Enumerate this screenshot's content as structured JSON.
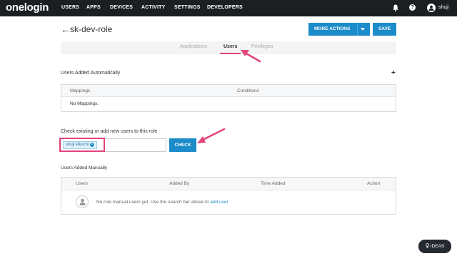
{
  "nav": {
    "logo": "onelogin",
    "items": [
      "USERS",
      "APPS",
      "DEVICES",
      "ACTIVITY",
      "SETTINGS",
      "DEVELOPERS"
    ],
    "help": "?",
    "username": "shuji"
  },
  "page": {
    "title": "sk-dev-role",
    "back_arrow": "←",
    "more_actions": "MORE ACTIONS",
    "save": "SAVE"
  },
  "tabs": [
    {
      "label": "Applications",
      "active": false
    },
    {
      "label": "Users",
      "active": true
    },
    {
      "label": "Privileges",
      "active": false
    }
  ],
  "auto_section": {
    "title": "Users Added Automatically",
    "add_icon": "+",
    "headers": [
      "Mappings",
      "Conditions"
    ],
    "empty_text": "No Mappings."
  },
  "check_section": {
    "title": "Check existing or add new users to this role",
    "token": "shuji kikuchi",
    "token_remove": "×",
    "check_button": "CHECK"
  },
  "manual_section": {
    "title": "Users Added Manually",
    "headers": [
      "Users",
      "Added By",
      "Time Added",
      "Action"
    ],
    "empty_text": "No role manual users yet. Use the search bar above to",
    "empty_link": "add user"
  },
  "ideas_button": "IDEAS",
  "colors": {
    "nav_bg": "#1c1f21",
    "primary": "#1c8bc9",
    "annotation": "#e2447b"
  }
}
